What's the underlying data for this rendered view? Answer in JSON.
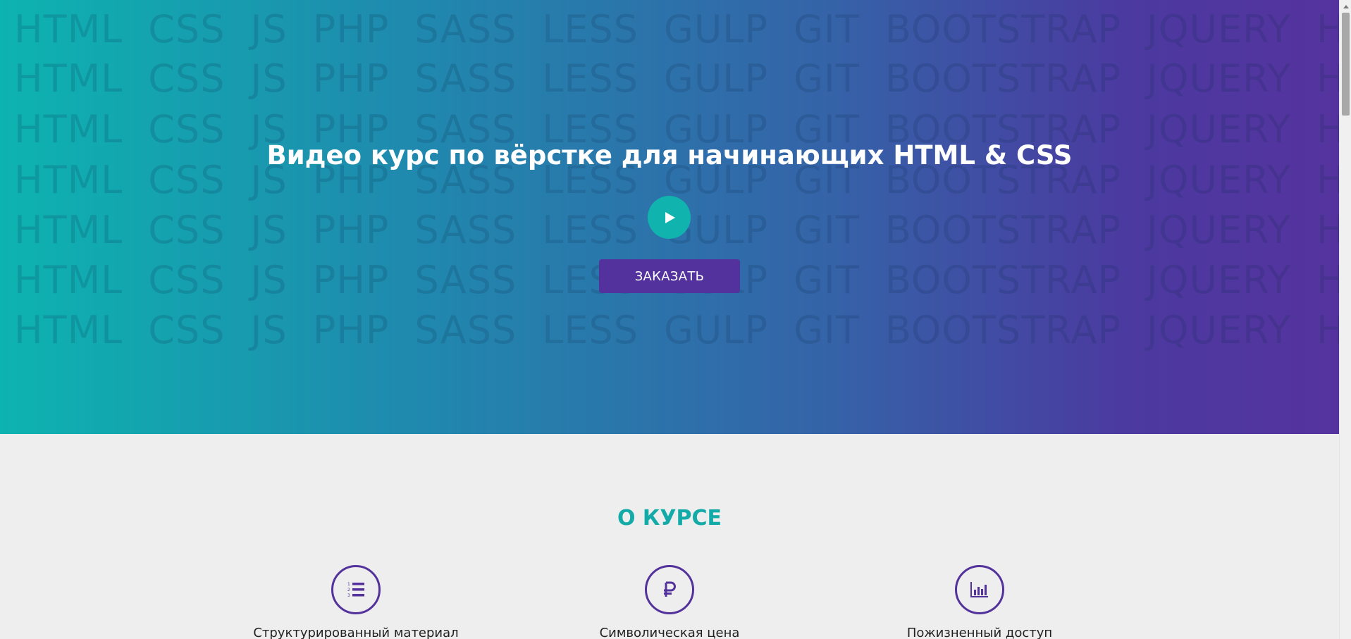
{
  "background_words": [
    "HTML",
    "CSS",
    "JS",
    "PHP",
    "SASS",
    "LESS",
    "GULP",
    "GIT",
    "BOOTSTRAP",
    "JQUERY",
    "HTML"
  ],
  "hero": {
    "title": "Видео курс по вёрстке для начинающих HTML & CSS",
    "play_icon": "play-icon",
    "order_button": "ЗАКАЗАТЬ"
  },
  "about": {
    "title": "О КУРСЕ",
    "features": [
      {
        "icon": "numbered-list-icon",
        "label": "Структурированный материал"
      },
      {
        "icon": "ruble-icon",
        "label": "Символическая цена"
      },
      {
        "icon": "bar-chart-icon",
        "label": "Пожизненный доступ"
      }
    ]
  },
  "colors": {
    "gradient_start": "#0db3b0",
    "gradient_end": "#55339e",
    "accent_teal": "#13aaa8",
    "accent_purple": "#53329e",
    "section_bg": "#eeeeee"
  }
}
